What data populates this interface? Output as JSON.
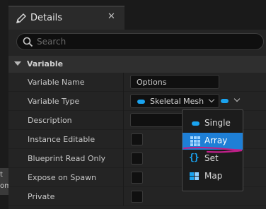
{
  "left_strip": {
    "button_text": "t\nom"
  },
  "tab": {
    "title": "Details",
    "close_glyph": "✕"
  },
  "search": {
    "placeholder": "Search",
    "value": ""
  },
  "section": {
    "title": "Variable"
  },
  "properties": {
    "variable_name": {
      "label": "Variable Name",
      "value": "Options"
    },
    "variable_type": {
      "label": "Variable Type",
      "value": "Skeletal Mesh"
    },
    "description": {
      "label": "Description",
      "value": ""
    },
    "instance_editable": {
      "label": "Instance Editable",
      "checked": false
    },
    "blueprint_read_only": {
      "label": "Blueprint Read Only",
      "checked": false
    },
    "expose_on_spawn": {
      "label": "Expose on Spawn",
      "checked": false
    },
    "private": {
      "label": "Private",
      "checked": false
    }
  },
  "container_dropdown": {
    "selected": "Array",
    "items": [
      {
        "label": "Single",
        "icon": "single-pill-icon"
      },
      {
        "label": "Array",
        "icon": "array-grid-icon"
      },
      {
        "label": "Set",
        "icon": "set-braces-icon"
      },
      {
        "label": "Map",
        "icon": "map-icon"
      }
    ]
  },
  "colors": {
    "type_pill": "#1aa3ef",
    "selection": "#1e7fd6",
    "annotation": "#c0208a",
    "panel_bg": "#242424"
  }
}
